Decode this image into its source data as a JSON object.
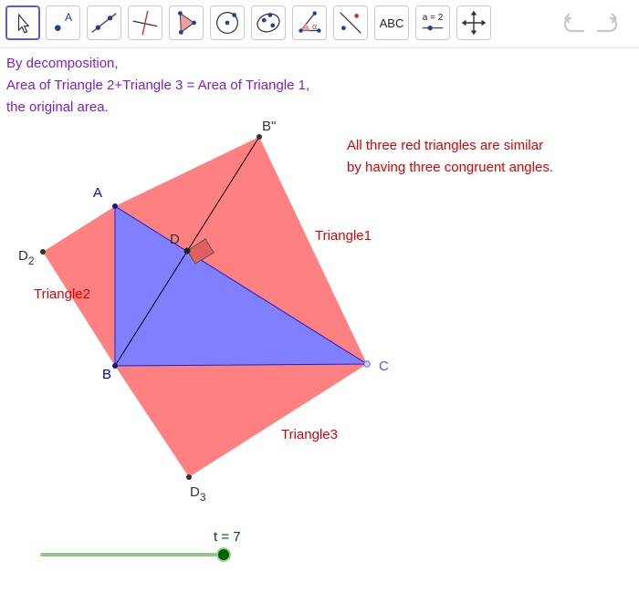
{
  "toolbar": {
    "tools": [
      {
        "icon": "move-icon"
      },
      {
        "icon": "point-icon",
        "text": "A"
      },
      {
        "icon": "line-icon"
      },
      {
        "icon": "perpendicular-line-icon"
      },
      {
        "icon": "polygon-icon"
      },
      {
        "icon": "circle-center-icon"
      },
      {
        "icon": "ellipse-icon"
      },
      {
        "icon": "angle-icon",
        "text": "α"
      },
      {
        "icon": "reflect-icon"
      },
      {
        "icon": "text-icon",
        "text": "ABC"
      },
      {
        "icon": "slider-icon",
        "text": "a = 2"
      },
      {
        "icon": "move-graphics-view-icon"
      }
    ]
  },
  "text": {
    "decomposition_lines": [
      "By decomposition,",
      "Area of Triangle 2+Triangle 3 = Area of Triangle 1,",
      "the original area."
    ],
    "similar_lines": [
      "All three red triangles are similar",
      "by having three congruent angles."
    ]
  },
  "labels": {
    "A": "A",
    "B": "B",
    "C": "C",
    "D": "D",
    "B2": "B\"",
    "D2_main": "D",
    "D2_sub": "2",
    "D3_main": "D",
    "D3_sub": "3",
    "tri1": "Triangle1",
    "tri2": "Triangle2",
    "tri3": "Triangle3"
  },
  "slider": {
    "label": "t = 7",
    "value": 7
  },
  "colors": {
    "red_fill": "#ff8080",
    "blue_fill": "#8080ff",
    "purple_text": "#7b1fd1",
    "red_text": "#e00000",
    "point_label": "#0000cc",
    "slider_track": "#99c18f",
    "slider_knob": "#006400"
  }
}
